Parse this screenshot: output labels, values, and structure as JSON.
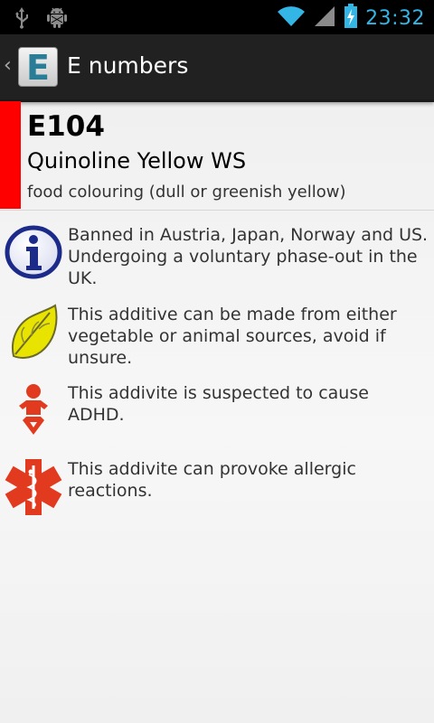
{
  "status_bar": {
    "time": "23:32",
    "icons": [
      "usb-icon",
      "android-debug-icon",
      "wifi-icon",
      "signal-icon",
      "battery-charging-icon"
    ]
  },
  "action_bar": {
    "app_icon_letter": "E",
    "title": "E numbers"
  },
  "additive": {
    "code": "E104",
    "name": "Quinoline Yellow WS",
    "category": "food colouring (dull or greenish yellow)",
    "severity_color": "#ff0000"
  },
  "notes": [
    {
      "icon": "info-icon",
      "text": "Banned in Austria, Japan, Norway and US. Undergoing a voluntary phase-out in the UK."
    },
    {
      "icon": "leaf-icon",
      "text": "This additive can be made from either vegetable or animal sources, avoid if unsure."
    },
    {
      "icon": "child-icon",
      "text": "This addivite is suspected to cause ADHD."
    },
    {
      "icon": "medical-star-icon",
      "text": "This addivite can provoke allergic reactions."
    }
  ]
}
